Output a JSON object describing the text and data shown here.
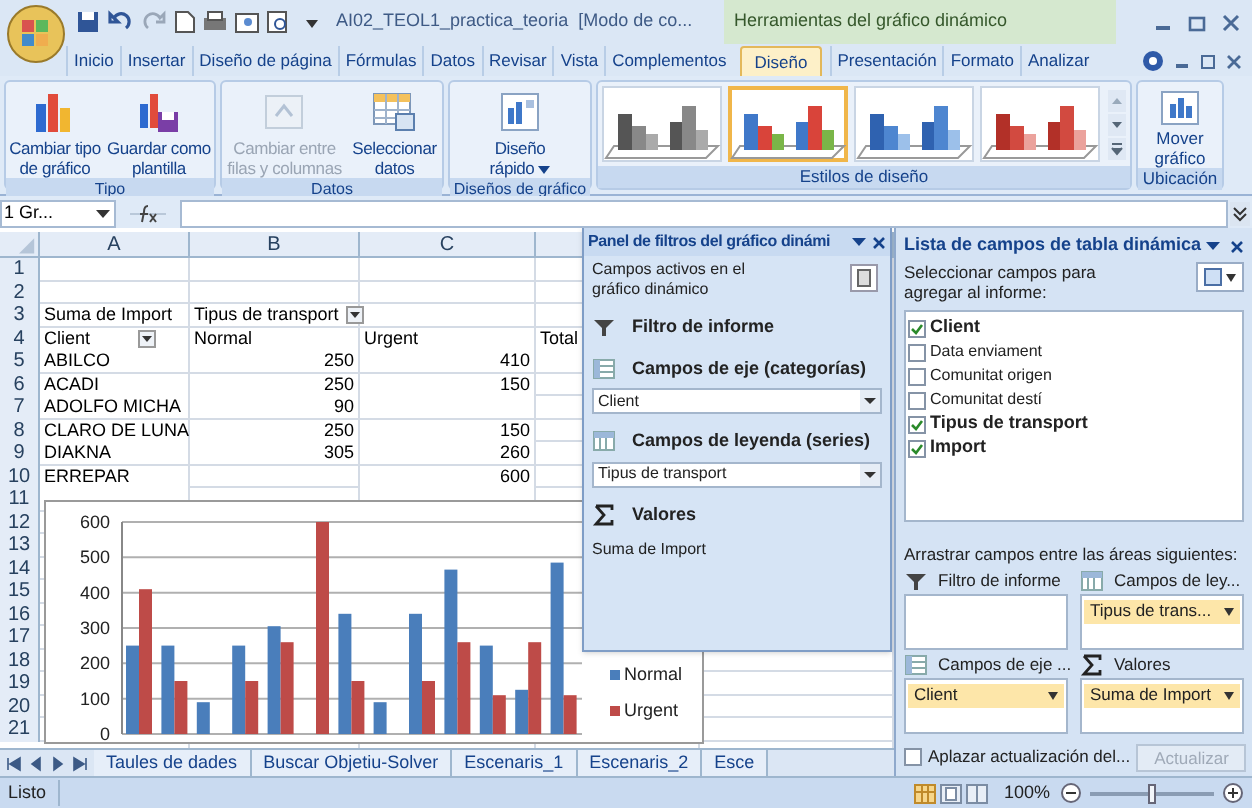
{
  "title_bar": {
    "title": "AI02_TEOL1_practica_teoria  [Modo de co...",
    "context_title": "Herramientas del gráfico dinámico"
  },
  "tabs": [
    {
      "label": "Inicio",
      "selected": false
    },
    {
      "label": "Insertar",
      "selected": false
    },
    {
      "label": "Diseño de página",
      "selected": false
    },
    {
      "label": "Fórmulas",
      "selected": false
    },
    {
      "label": "Datos",
      "selected": false
    },
    {
      "label": "Revisar",
      "selected": false
    },
    {
      "label": "Vista",
      "selected": false
    },
    {
      "label": "Complementos",
      "selected": false
    },
    {
      "label": "Diseño",
      "selected": true
    },
    {
      "label": "Presentación",
      "selected": false
    },
    {
      "label": "Formato",
      "selected": false
    },
    {
      "label": "Analizar",
      "selected": false
    }
  ],
  "ribbon": {
    "groups": [
      {
        "label": "Tipo",
        "buttons": [
          {
            "label": "Cambiar tipo\nde gráfico",
            "kind": "bars",
            "disabled": false,
            "dropdown": false
          },
          {
            "label": "Guardar como\nplantilla",
            "kind": "save",
            "disabled": false,
            "dropdown": false
          }
        ]
      },
      {
        "label": "Datos",
        "buttons": [
          {
            "label": "Cambiar entre\nfilas y columnas",
            "kind": "switch",
            "disabled": true,
            "dropdown": false
          },
          {
            "label": "Seleccionar\ndatos",
            "kind": "table",
            "disabled": false,
            "dropdown": false
          }
        ]
      },
      {
        "label": "Diseños de gráfico",
        "buttons": [
          {
            "label": "Diseño\nrápido",
            "kind": "layout",
            "disabled": false,
            "dropdown": true
          }
        ]
      }
    ],
    "styles_label": "Estilos de diseño",
    "styles": [
      {
        "kind": "gray",
        "selected": false
      },
      {
        "kind": "multi",
        "selected": true
      },
      {
        "kind": "blue",
        "selected": false
      },
      {
        "kind": "red",
        "selected": false
      }
    ],
    "location": {
      "label": "Ubicación",
      "button": "Mover\ngráfico"
    }
  },
  "formula_bar": {
    "name_box": "1 Gr..."
  },
  "sheet": {
    "columns": [
      "A",
      "B",
      "C"
    ],
    "rows": [
      {
        "number": "1",
        "kind": "blank",
        "cells": []
      },
      {
        "number": "2",
        "kind": "blank",
        "cells": []
      },
      {
        "number": "3",
        "kind": "header",
        "cells": [
          "Suma de Import",
          "Tipus de transport"
        ]
      },
      {
        "number": "4",
        "kind": "header",
        "cells": [
          "Client",
          "Normal",
          "Urgent",
          "Total"
        ]
      },
      {
        "number": "5",
        "kind": "data",
        "cells": [
          "ABILCO",
          "250",
          "410"
        ]
      },
      {
        "number": "6",
        "kind": "data",
        "cells": [
          "ACADI",
          "250",
          "150"
        ]
      },
      {
        "number": "7",
        "kind": "data",
        "cells": [
          "ADOLFO MICHA",
          "90",
          ""
        ]
      },
      {
        "number": "8",
        "kind": "data",
        "cells": [
          "CLARO DE LUNA",
          "250",
          "150"
        ]
      },
      {
        "number": "9",
        "kind": "data",
        "cells": [
          "DIAKNA",
          "305",
          "260"
        ]
      },
      {
        "number": "10",
        "kind": "data",
        "cells": [
          "ERREPAR",
          "",
          "600"
        ]
      },
      {
        "number": "11",
        "kind": "blank",
        "cells": []
      },
      {
        "number": "12",
        "kind": "blank",
        "cells": []
      },
      {
        "number": "13",
        "kind": "blank",
        "cells": []
      },
      {
        "number": "14",
        "kind": "blank",
        "cells": []
      },
      {
        "number": "15",
        "kind": "blank",
        "cells": []
      },
      {
        "number": "16",
        "kind": "blank",
        "cells": []
      },
      {
        "number": "17",
        "kind": "blank",
        "cells": []
      },
      {
        "number": "18",
        "kind": "blank",
        "cells": []
      },
      {
        "number": "19",
        "kind": "blank",
        "cells": []
      },
      {
        "number": "20",
        "kind": "blank",
        "cells": []
      },
      {
        "number": "21",
        "kind": "blank",
        "cells": []
      }
    ],
    "tabs": [
      "Taules de dades",
      "Buscar Objetiu-Solver",
      "Escenaris_1",
      "Escenaris_2",
      "Esce"
    ]
  },
  "chart": {
    "chart_data": {
      "type": "bar",
      "grid": true,
      "legend": true,
      "ylim": [
        0,
        600
      ],
      "yticks": [
        {
          "value": 0,
          "label": "0"
        },
        {
          "value": 100,
          "label": "100"
        },
        {
          "value": 200,
          "label": "200"
        },
        {
          "value": 300,
          "label": "300"
        },
        {
          "value": 400,
          "label": "400"
        },
        {
          "value": 500,
          "label": "500"
        },
        {
          "value": 600,
          "label": "600"
        }
      ],
      "series": [
        {
          "name": "Normal",
          "color": "#4a7ebb",
          "values": [
            250,
            250,
            90,
            250,
            305,
            null,
            340,
            90,
            340,
            465,
            250,
            125,
            485
          ]
        },
        {
          "name": "Urgent",
          "color": "#be4b48",
          "values": [
            410,
            150,
            null,
            150,
            260,
            600,
            150,
            null,
            150,
            260,
            110,
            260,
            110
          ]
        }
      ]
    }
  },
  "filter_panel": {
    "title": "Panel de filtros del gráfico dinámi",
    "subtitle": "Campos activos en el gráfico dinámico",
    "sections": [
      {
        "kind": "filter",
        "label": "Filtro de informe"
      },
      {
        "kind": "axis",
        "label": "Campos de eje (categorías)",
        "value": "Client"
      },
      {
        "kind": "legend",
        "label": "Campos de leyenda (series)",
        "value": "Tipus de transport"
      },
      {
        "kind": "values",
        "label": "Valores",
        "text": "Suma de Import"
      }
    ]
  },
  "field_list": {
    "title": "Lista de campos de tabla dinámica",
    "prompt": "Seleccionar campos para agregar al informe:",
    "fields": [
      {
        "label": "Client",
        "checked": true
      },
      {
        "label": "Data enviament",
        "checked": false
      },
      {
        "label": "Comunitat origen",
        "checked": false
      },
      {
        "label": "Comunitat destí",
        "checked": false
      },
      {
        "label": "Tipus de transport",
        "checked": true
      },
      {
        "label": "Import",
        "checked": true
      }
    ],
    "areas_prompt": "Arrastrar campos entre las áreas siguientes:",
    "areas": [
      {
        "kind": "filter",
        "label": "Filtro de informe"
      },
      {
        "kind": "legend",
        "label": "Campos de ley...",
        "items": [
          "Tipus de trans..."
        ]
      },
      {
        "kind": "axis",
        "label": "Campos de eje ...",
        "items": [
          "Client"
        ]
      },
      {
        "kind": "values",
        "label": "Valores",
        "items": [
          "Suma de Import"
        ]
      }
    ],
    "defer": {
      "label": "Aplazar actualización del...",
      "checked": false
    },
    "update_button": {
      "label": "Actualizar",
      "disabled": true
    }
  },
  "status_bar": {
    "text": "Listo",
    "zoom": "100%",
    "level": 0.5
  }
}
